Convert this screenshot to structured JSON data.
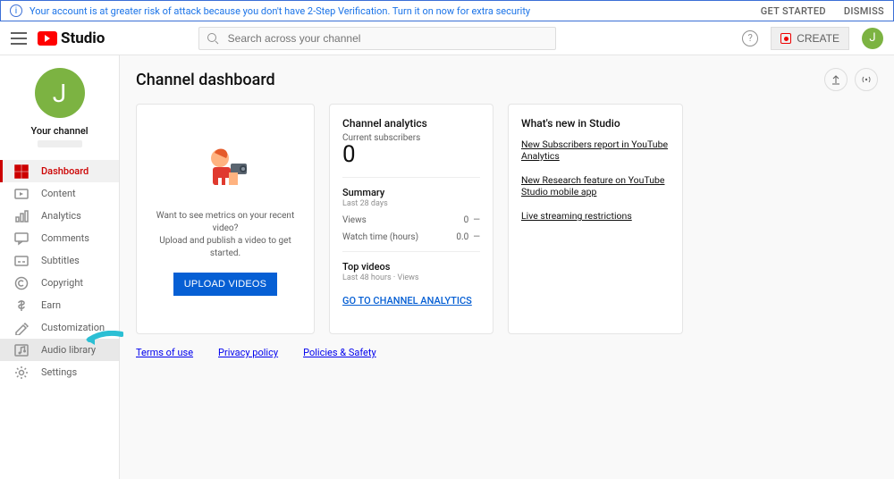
{
  "banner": {
    "message": "Your account is at greater risk of attack because you don't have 2-Step Verification. Turn it on now for extra security",
    "get_started": "GET STARTED",
    "dismiss": "DISMISS"
  },
  "header": {
    "brand": "Studio",
    "search_placeholder": "Search across your channel",
    "create": "CREATE",
    "avatar_letter": "J"
  },
  "sidebar": {
    "channel_avatar": "J",
    "channel_label": "Your channel",
    "items": [
      {
        "label": "Dashboard",
        "icon": "dashboard"
      },
      {
        "label": "Content",
        "icon": "content"
      },
      {
        "label": "Analytics",
        "icon": "analytics"
      },
      {
        "label": "Comments",
        "icon": "comments"
      },
      {
        "label": "Subtitles",
        "icon": "subtitles"
      },
      {
        "label": "Copyright",
        "icon": "copyright"
      },
      {
        "label": "Earn",
        "icon": "earn"
      },
      {
        "label": "Customization",
        "icon": "customization"
      },
      {
        "label": "Audio library",
        "icon": "audio"
      }
    ],
    "settings": "Settings"
  },
  "page": {
    "title": "Channel dashboard"
  },
  "upload_card": {
    "line1": "Want to see metrics on your recent video?",
    "line2": "Upload and publish a video to get started.",
    "button": "UPLOAD VIDEOS"
  },
  "analytics_card": {
    "title": "Channel analytics",
    "subs_label": "Current subscribers",
    "subs_value": "0",
    "summary_title": "Summary",
    "summary_period": "Last 28 days",
    "rows": [
      {
        "label": "Views",
        "value": "0",
        "delta": "—"
      },
      {
        "label": "Watch time (hours)",
        "value": "0.0",
        "delta": "—"
      }
    ],
    "top_title": "Top videos",
    "top_sub": "Last 48 hours · Views",
    "link": "GO TO CHANNEL ANALYTICS"
  },
  "news_card": {
    "title": "What's new in Studio",
    "items": [
      "New Subscribers report in YouTube Analytics",
      "New Research feature on YouTube Studio mobile app",
      "Live streaming restrictions"
    ]
  },
  "footer": {
    "terms": "Terms of use",
    "privacy": "Privacy policy",
    "policies": "Policies & Safety"
  }
}
